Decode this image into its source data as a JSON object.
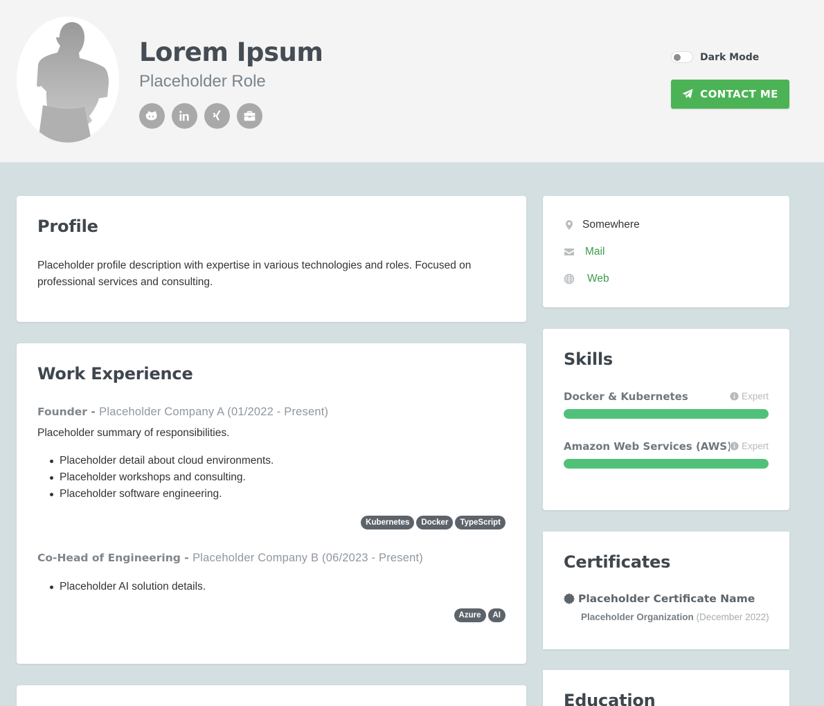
{
  "header": {
    "name": "Lorem Ipsum",
    "role": "Placeholder Role",
    "socials": [
      {
        "icon": "github-icon"
      },
      {
        "icon": "linkedin-icon"
      },
      {
        "icon": "xing-icon"
      },
      {
        "icon": "briefcase-icon"
      }
    ],
    "dark_mode_label": "Dark Mode",
    "contact_label": "CONTACT ME"
  },
  "profile": {
    "title": "Profile",
    "text": "Placeholder profile description with expertise in various technologies and roles. Focused on professional services and consulting."
  },
  "experience": {
    "title": "Work Experience",
    "jobs": [
      {
        "role": "Founder",
        "company": "Placeholder Company A (01/2022 - Present)",
        "summary": "Placeholder summary of responsibilities.",
        "details": [
          "Placeholder detail about cloud environments.",
          "Placeholder workshops and consulting.",
          "Placeholder software engineering."
        ],
        "tags": [
          "Kubernetes",
          "Docker",
          "TypeScript"
        ]
      },
      {
        "role": "Co-Head of Engineering",
        "company": "Placeholder Company B (06/2023 - Present)",
        "details": [
          "Placeholder AI solution details."
        ],
        "tags": [
          "Azure",
          "AI"
        ]
      }
    ]
  },
  "contact_info": {
    "location": "Somewhere",
    "mail": "Mail",
    "web": "Web"
  },
  "skills": {
    "title": "Skills",
    "items": [
      {
        "name": "Docker & Kubernetes",
        "level": "Expert",
        "progress": 1.0
      },
      {
        "name": "Amazon Web Services (AWS)",
        "level": "Expert",
        "progress": 1.0
      }
    ]
  },
  "certificates": {
    "title": "Certificates",
    "items": [
      {
        "name": "Placeholder Certificate Name",
        "org": "Placeholder Organization",
        "date": "(December 2022)"
      }
    ]
  },
  "education": {
    "title": "Education"
  },
  "colors": {
    "accent": "#4bb356",
    "skill_bar": "#51c17a",
    "background": "#d3dfe1"
  }
}
